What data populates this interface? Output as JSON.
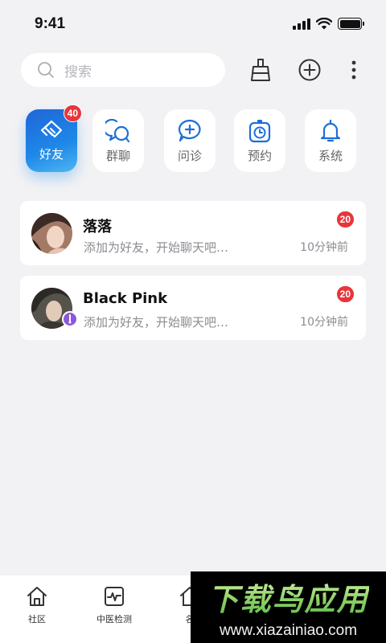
{
  "status_bar": {
    "time": "9:41"
  },
  "search": {
    "placeholder": "搜索"
  },
  "categories": [
    {
      "label": "好友",
      "icon": "handshake-icon",
      "badge": "40",
      "active": true
    },
    {
      "label": "群聊",
      "icon": "group-chat-icon"
    },
    {
      "label": "问诊",
      "icon": "consult-icon"
    },
    {
      "label": "预约",
      "icon": "appointment-icon"
    },
    {
      "label": "系统",
      "icon": "bell-icon"
    }
  ],
  "chats": [
    {
      "name": "落落",
      "preview": "添加为好友，开始聊天吧…",
      "time": "10分钟前",
      "badge": "20"
    },
    {
      "name": "Black Pink",
      "preview": "添加为好友，开始聊天吧…",
      "time": "10分钟前",
      "badge": "20"
    }
  ],
  "nav": [
    {
      "label": "社区",
      "icon": "home-icon"
    },
    {
      "label": "中医检测",
      "icon": "pulse-monitor-icon"
    },
    {
      "label": "名",
      "icon": "doctor-icon"
    }
  ],
  "watermark": {
    "title": "下载鸟应用",
    "url": "www.xiazainiao.com"
  },
  "colors": {
    "accent": "#1e7fe4",
    "badge": "#e8353b",
    "background": "#f2f2f4"
  }
}
